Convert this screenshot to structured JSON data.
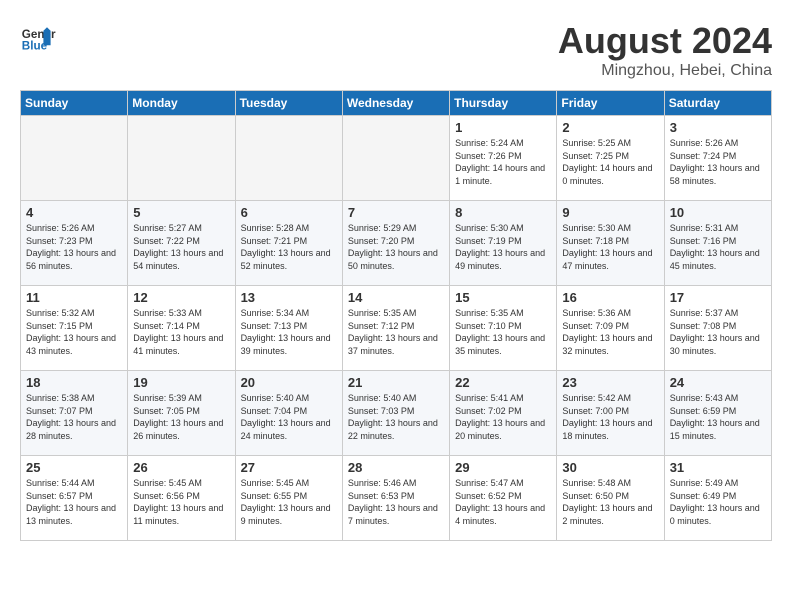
{
  "header": {
    "logo_line1": "General",
    "logo_line2": "Blue",
    "title": "August 2024",
    "subtitle": "Mingzhou, Hebei, China"
  },
  "days_of_week": [
    "Sunday",
    "Monday",
    "Tuesday",
    "Wednesday",
    "Thursday",
    "Friday",
    "Saturday"
  ],
  "weeks": [
    [
      {
        "day": "",
        "empty": true
      },
      {
        "day": "",
        "empty": true
      },
      {
        "day": "",
        "empty": true
      },
      {
        "day": "",
        "empty": true
      },
      {
        "day": "1",
        "line1": "Sunrise: 5:24 AM",
        "line2": "Sunset: 7:26 PM",
        "line3": "Daylight: 14 hours",
        "line4": "and 1 minute."
      },
      {
        "day": "2",
        "line1": "Sunrise: 5:25 AM",
        "line2": "Sunset: 7:25 PM",
        "line3": "Daylight: 14 hours",
        "line4": "and 0 minutes."
      },
      {
        "day": "3",
        "line1": "Sunrise: 5:26 AM",
        "line2": "Sunset: 7:24 PM",
        "line3": "Daylight: 13 hours",
        "line4": "and 58 minutes."
      }
    ],
    [
      {
        "day": "4",
        "line1": "Sunrise: 5:26 AM",
        "line2": "Sunset: 7:23 PM",
        "line3": "Daylight: 13 hours",
        "line4": "and 56 minutes."
      },
      {
        "day": "5",
        "line1": "Sunrise: 5:27 AM",
        "line2": "Sunset: 7:22 PM",
        "line3": "Daylight: 13 hours",
        "line4": "and 54 minutes."
      },
      {
        "day": "6",
        "line1": "Sunrise: 5:28 AM",
        "line2": "Sunset: 7:21 PM",
        "line3": "Daylight: 13 hours",
        "line4": "and 52 minutes."
      },
      {
        "day": "7",
        "line1": "Sunrise: 5:29 AM",
        "line2": "Sunset: 7:20 PM",
        "line3": "Daylight: 13 hours",
        "line4": "and 50 minutes."
      },
      {
        "day": "8",
        "line1": "Sunrise: 5:30 AM",
        "line2": "Sunset: 7:19 PM",
        "line3": "Daylight: 13 hours",
        "line4": "and 49 minutes."
      },
      {
        "day": "9",
        "line1": "Sunrise: 5:30 AM",
        "line2": "Sunset: 7:18 PM",
        "line3": "Daylight: 13 hours",
        "line4": "and 47 minutes."
      },
      {
        "day": "10",
        "line1": "Sunrise: 5:31 AM",
        "line2": "Sunset: 7:16 PM",
        "line3": "Daylight: 13 hours",
        "line4": "and 45 minutes."
      }
    ],
    [
      {
        "day": "11",
        "line1": "Sunrise: 5:32 AM",
        "line2": "Sunset: 7:15 PM",
        "line3": "Daylight: 13 hours",
        "line4": "and 43 minutes."
      },
      {
        "day": "12",
        "line1": "Sunrise: 5:33 AM",
        "line2": "Sunset: 7:14 PM",
        "line3": "Daylight: 13 hours",
        "line4": "and 41 minutes."
      },
      {
        "day": "13",
        "line1": "Sunrise: 5:34 AM",
        "line2": "Sunset: 7:13 PM",
        "line3": "Daylight: 13 hours",
        "line4": "and 39 minutes."
      },
      {
        "day": "14",
        "line1": "Sunrise: 5:35 AM",
        "line2": "Sunset: 7:12 PM",
        "line3": "Daylight: 13 hours",
        "line4": "and 37 minutes."
      },
      {
        "day": "15",
        "line1": "Sunrise: 5:35 AM",
        "line2": "Sunset: 7:10 PM",
        "line3": "Daylight: 13 hours",
        "line4": "and 35 minutes."
      },
      {
        "day": "16",
        "line1": "Sunrise: 5:36 AM",
        "line2": "Sunset: 7:09 PM",
        "line3": "Daylight: 13 hours",
        "line4": "and 32 minutes."
      },
      {
        "day": "17",
        "line1": "Sunrise: 5:37 AM",
        "line2": "Sunset: 7:08 PM",
        "line3": "Daylight: 13 hours",
        "line4": "and 30 minutes."
      }
    ],
    [
      {
        "day": "18",
        "line1": "Sunrise: 5:38 AM",
        "line2": "Sunset: 7:07 PM",
        "line3": "Daylight: 13 hours",
        "line4": "and 28 minutes."
      },
      {
        "day": "19",
        "line1": "Sunrise: 5:39 AM",
        "line2": "Sunset: 7:05 PM",
        "line3": "Daylight: 13 hours",
        "line4": "and 26 minutes."
      },
      {
        "day": "20",
        "line1": "Sunrise: 5:40 AM",
        "line2": "Sunset: 7:04 PM",
        "line3": "Daylight: 13 hours",
        "line4": "and 24 minutes."
      },
      {
        "day": "21",
        "line1": "Sunrise: 5:40 AM",
        "line2": "Sunset: 7:03 PM",
        "line3": "Daylight: 13 hours",
        "line4": "and 22 minutes."
      },
      {
        "day": "22",
        "line1": "Sunrise: 5:41 AM",
        "line2": "Sunset: 7:02 PM",
        "line3": "Daylight: 13 hours",
        "line4": "and 20 minutes."
      },
      {
        "day": "23",
        "line1": "Sunrise: 5:42 AM",
        "line2": "Sunset: 7:00 PM",
        "line3": "Daylight: 13 hours",
        "line4": "and 18 minutes."
      },
      {
        "day": "24",
        "line1": "Sunrise: 5:43 AM",
        "line2": "Sunset: 6:59 PM",
        "line3": "Daylight: 13 hours",
        "line4": "and 15 minutes."
      }
    ],
    [
      {
        "day": "25",
        "line1": "Sunrise: 5:44 AM",
        "line2": "Sunset: 6:57 PM",
        "line3": "Daylight: 13 hours",
        "line4": "and 13 minutes."
      },
      {
        "day": "26",
        "line1": "Sunrise: 5:45 AM",
        "line2": "Sunset: 6:56 PM",
        "line3": "Daylight: 13 hours",
        "line4": "and 11 minutes."
      },
      {
        "day": "27",
        "line1": "Sunrise: 5:45 AM",
        "line2": "Sunset: 6:55 PM",
        "line3": "Daylight: 13 hours",
        "line4": "and 9 minutes."
      },
      {
        "day": "28",
        "line1": "Sunrise: 5:46 AM",
        "line2": "Sunset: 6:53 PM",
        "line3": "Daylight: 13 hours",
        "line4": "and 7 minutes."
      },
      {
        "day": "29",
        "line1": "Sunrise: 5:47 AM",
        "line2": "Sunset: 6:52 PM",
        "line3": "Daylight: 13 hours",
        "line4": "and 4 minutes."
      },
      {
        "day": "30",
        "line1": "Sunrise: 5:48 AM",
        "line2": "Sunset: 6:50 PM",
        "line3": "Daylight: 13 hours",
        "line4": "and 2 minutes."
      },
      {
        "day": "31",
        "line1": "Sunrise: 5:49 AM",
        "line2": "Sunset: 6:49 PM",
        "line3": "Daylight: 13 hours",
        "line4": "and 0 minutes."
      }
    ]
  ]
}
